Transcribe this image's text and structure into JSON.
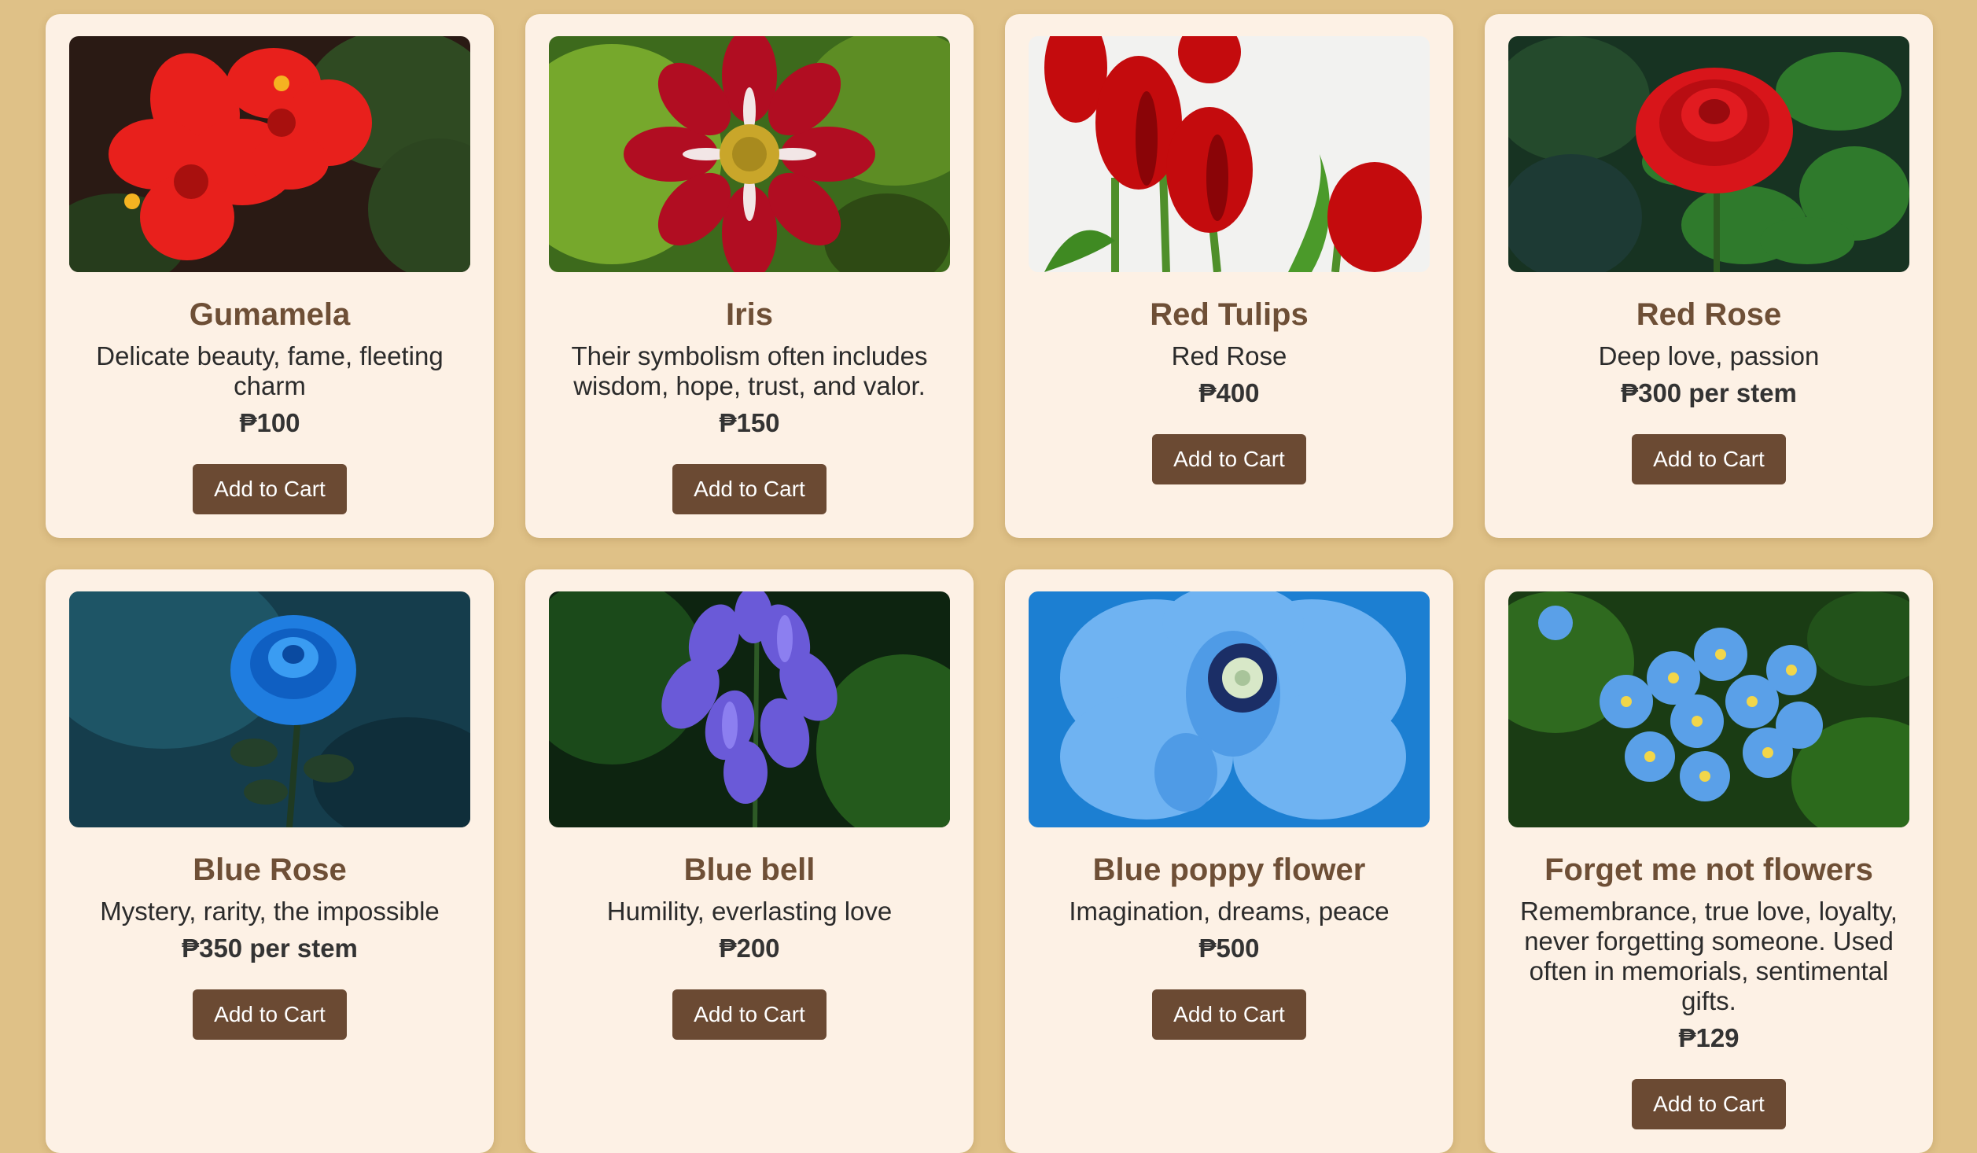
{
  "currency_symbol": "₱",
  "add_to_cart_label": "Add to Cart",
  "products": [
    {
      "name": "Gumamela",
      "description": "Delicate beauty, fame, fleeting charm",
      "price": "₱100"
    },
    {
      "name": "Iris",
      "description": "Their symbolism often includes wisdom, hope, trust, and valor.",
      "price": "₱150"
    },
    {
      "name": "Red Tulips",
      "description": "Red Rose",
      "price": "₱400"
    },
    {
      "name": "Red Rose",
      "description": "Deep love, passion",
      "price": "₱300 per stem"
    },
    {
      "name": "Blue Rose",
      "description": "Mystery, rarity, the impossible",
      "price": "₱350 per stem"
    },
    {
      "name": "Blue bell",
      "description": "Humility, everlasting love",
      "price": "₱200"
    },
    {
      "name": "Blue poppy flower",
      "description": "Imagination, dreams, peace",
      "price": "₱500"
    },
    {
      "name": "Forget me not flowers",
      "description": "Remembrance, true love, loyalty, never forgetting someone. Used often in memorials, sentimental gifts.",
      "price": "₱129"
    }
  ],
  "colors": {
    "page_background": "#dfc187",
    "card_background": "#fdf1e5",
    "title_brown": "#6e4f36",
    "button_brown": "#6b4a33"
  }
}
